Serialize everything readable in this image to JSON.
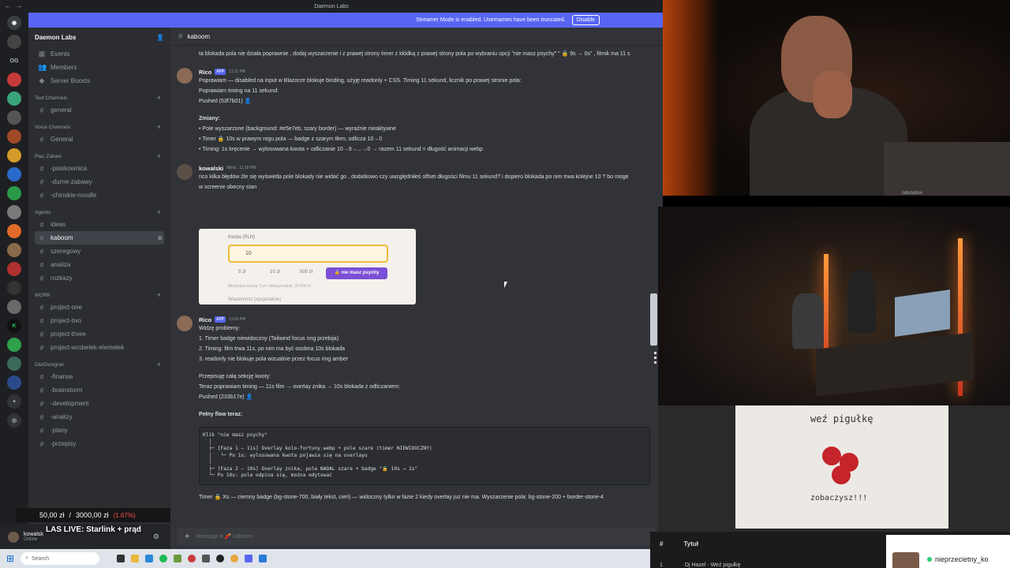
{
  "window": {
    "title": "Daemon Labs",
    "nav": "← →"
  },
  "banner": {
    "text": "Streamer Mode is enabled. Usernames have been truncated.",
    "disable": "Disable"
  },
  "rail": {
    "items": [
      "discord-icon",
      "OG",
      "server",
      "server",
      "server",
      "server",
      "server",
      "server"
    ],
    "og": "OG"
  },
  "sidebar": {
    "guild": "Daemon Labs",
    "top_items": [
      {
        "icon": "calendar-icon",
        "label": "Events"
      },
      {
        "icon": "members-icon",
        "label": "Members"
      },
      {
        "icon": "boost-icon",
        "label": "Server Boosts"
      }
    ],
    "categories": [
      {
        "name": "Text Channels",
        "channels": [
          "general"
        ]
      },
      {
        "name": "Voice Channels",
        "channels": [
          "General"
        ]
      },
      {
        "name": "Plac Zabaw",
        "channels": [
          "-piaskownica",
          "-durne-zabawy",
          "-chinskie-noodle"
        ]
      },
      {
        "name": "Agents",
        "channels": [
          "ideas",
          "kaboom",
          "szeregowy",
          "analiza",
          "rozkazy"
        ]
      },
      {
        "name": "WORK",
        "channels": [
          "project-one",
          "project-two",
          "project-three",
          "project-wrobelek-elemelek"
        ]
      },
      {
        "name": "DietDesigner",
        "channels": [
          "-finanse",
          "-brainstorm",
          "-development",
          "-analizy",
          "-plany",
          "-przepisy"
        ]
      }
    ],
    "active_channel": "kaboom"
  },
  "user_panel": {
    "name": "kowalsk",
    "status": "Online"
  },
  "stream_overlay": {
    "price": "50,00 zł",
    "target": "3000,00 zł",
    "pct": "(1.67%)",
    "live": "LAS LIVE: Starlink + prąd"
  },
  "chat": {
    "channel": "kaboom",
    "first_line": "ta blokada pola nie działa poprawnie , dodaj wyszarzenie i z prawej strony timer z kłódką z prawej strony pola po wybraniu opcji \"nie masz psychy\" \" 🔒 9s → 0s\" , filmik ma 11 s",
    "messages": [
      {
        "author": "Rico",
        "badge": "APP",
        "time": "11:11 PM",
        "lines": [
          "Poprawiam — disabled na input w Blazorze blokuje binding, użyję readonly + CSS. Timing 11 sekund, licznik po prawej stronie pola:",
          "Poprawiam timing na 11 sekund:",
          "Pushed (53f7b01) 👤",
          "Zmiany:",
          "Pole wyszarzone (background: #e5e7eb, szary border) — wyraźnie nieaktywne",
          "Timer 🔒 10s w prawym rogu pola — badge z szarym tłem, odlicza 10→0",
          "Timing: 1s kręcenie → wylosowana kwota + odliczanie 10→9→...→0 → razem 11 sekund = długość animacji webp"
        ]
      },
      {
        "author": "kowalski",
        "badge": "Mind",
        "time": "11:18 PM",
        "lines": [
          "rico kilka błędów źle się wyświetla pole blokady nie widać go , dodatkowo czy uwzględniłeś offset długości filmu 11 sekund? i dopiero blokada po nim trwa kolejne 10 ? bo moge",
          "w screenie obecny stan"
        ]
      },
      {
        "author": "Rico",
        "badge": "APP",
        "time": "11:20 PM",
        "lines": [
          "Widzę problemy:",
          "1. Timer badge niewidoczny (Tailwind focus ring przebija)",
          "2. Timing: film trwa 11s, po nim ma być osobna 10s blokada",
          "3. readonly nie blokuje pola wizualnie przez focus ring amber",
          "Przepisuję całą sekcję kwoty:",
          "Teraz poprawiam timing — 11s film → overlay znika → 10s blokada z odliczaniem:",
          "Pushed (233b17e) 👤",
          "Pełny flow teraz:",
          "Timer 🔒 Xs — ciemny badge (bg-stone-700, biały tekst, cień) — widoczny tylko w fazie 2 kiedy overlay już nie ma. Wyszarzenie pola: bg-stone-200 + border-stone-4"
        ]
      }
    ],
    "codeblock": "Klik \"nie masz psychy\"\n  │\n  ├─ [Faza 1 — 11s] Overlay kolo-fortuny.webp + pole szare (timer NIEWIDOCZNY)\n  │   └─ Po 1s: wylosowana kwota pojawia się na overlayu\n  │\n  ├─ [Faza 2 — 10s] Overlay znika, pole NADAL szare + badge \"🔒 10s → 1s\"\n  └─ Po 10s: pole odpina się, można edytować",
    "embed": {
      "label": "Kwota (PLN)",
      "amount": "10",
      "chips": [
        "5 zł",
        "10 zł",
        "500 zł"
      ],
      "psych_button": "🔒 nie masz psychy",
      "hint": "Minimalna kwota: 5 zł • Maksymalnie: 20 000 zł",
      "msg_label": "Wiadomość (opcjonalnie)"
    },
    "input_placeholder": "Message # 🧨 kaboom"
  },
  "taskbar": {
    "search": "Search"
  },
  "playlist": {
    "col_num": "#",
    "col_title": "Tytuł",
    "row_num": "1",
    "row_title": "Dj Hazel - Weź pigułkę"
  },
  "viewer": {
    "name": "nieprzecietny_ko"
  },
  "shirt": {
    "line1": "weź pigułkę",
    "line2": "zobaczysz!!!"
  },
  "cam1_caption": "tabulatów."
}
